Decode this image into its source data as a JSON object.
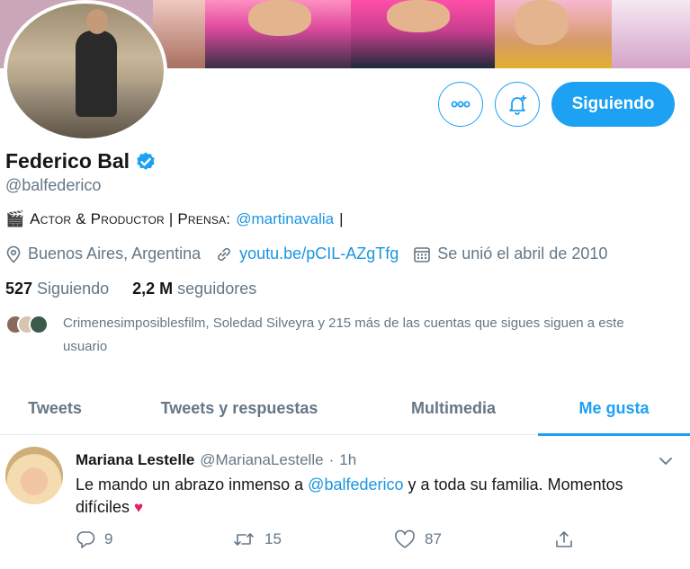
{
  "profile": {
    "name": "Federico Bal",
    "handle": "@balfederico",
    "bio_emoji": "🎬",
    "bio_text": "Actor & Productor | Prensa:",
    "bio_mention": "@martinavalia",
    "bio_suffix": "|",
    "location": "Buenos Aires, Argentina",
    "website": "youtu.be/pCIL-AZgTfg",
    "joined": "Se unió el abril de 2010",
    "following_count": "527",
    "following_label": "Siguiendo",
    "followers_count": "2,2 M",
    "followers_label": "seguidores",
    "known_followers": "Crimenesimposiblesfilm, Soledad Silveyra y 215 más de las cuentas que sigues siguen a este usuario"
  },
  "buttons": {
    "follow_label": "Siguiendo",
    "more_icon": "more-dots-icon",
    "notify_icon": "bell-plus-icon"
  },
  "tabs": [
    {
      "label": "Tweets",
      "active": false
    },
    {
      "label": "Tweets y respuestas",
      "active": false
    },
    {
      "label": "Multimedia",
      "active": false
    },
    {
      "label": "Me gusta",
      "active": true
    }
  ],
  "tweet": {
    "author": "Mariana Lestelle",
    "handle": "@MarianaLestelle",
    "separator": "·",
    "time": "1h",
    "text_before": "Le mando un abrazo inmenso a ",
    "mention": "@balfederico",
    "text_after": " y a toda su familia. Momentos difíciles ",
    "emoji": "♥",
    "replies": "9",
    "retweets": "15",
    "likes": "87"
  },
  "colors": {
    "accent": "#1da1f2",
    "link": "#1b95e0",
    "muted": "#657786",
    "like": "#e0245e"
  }
}
